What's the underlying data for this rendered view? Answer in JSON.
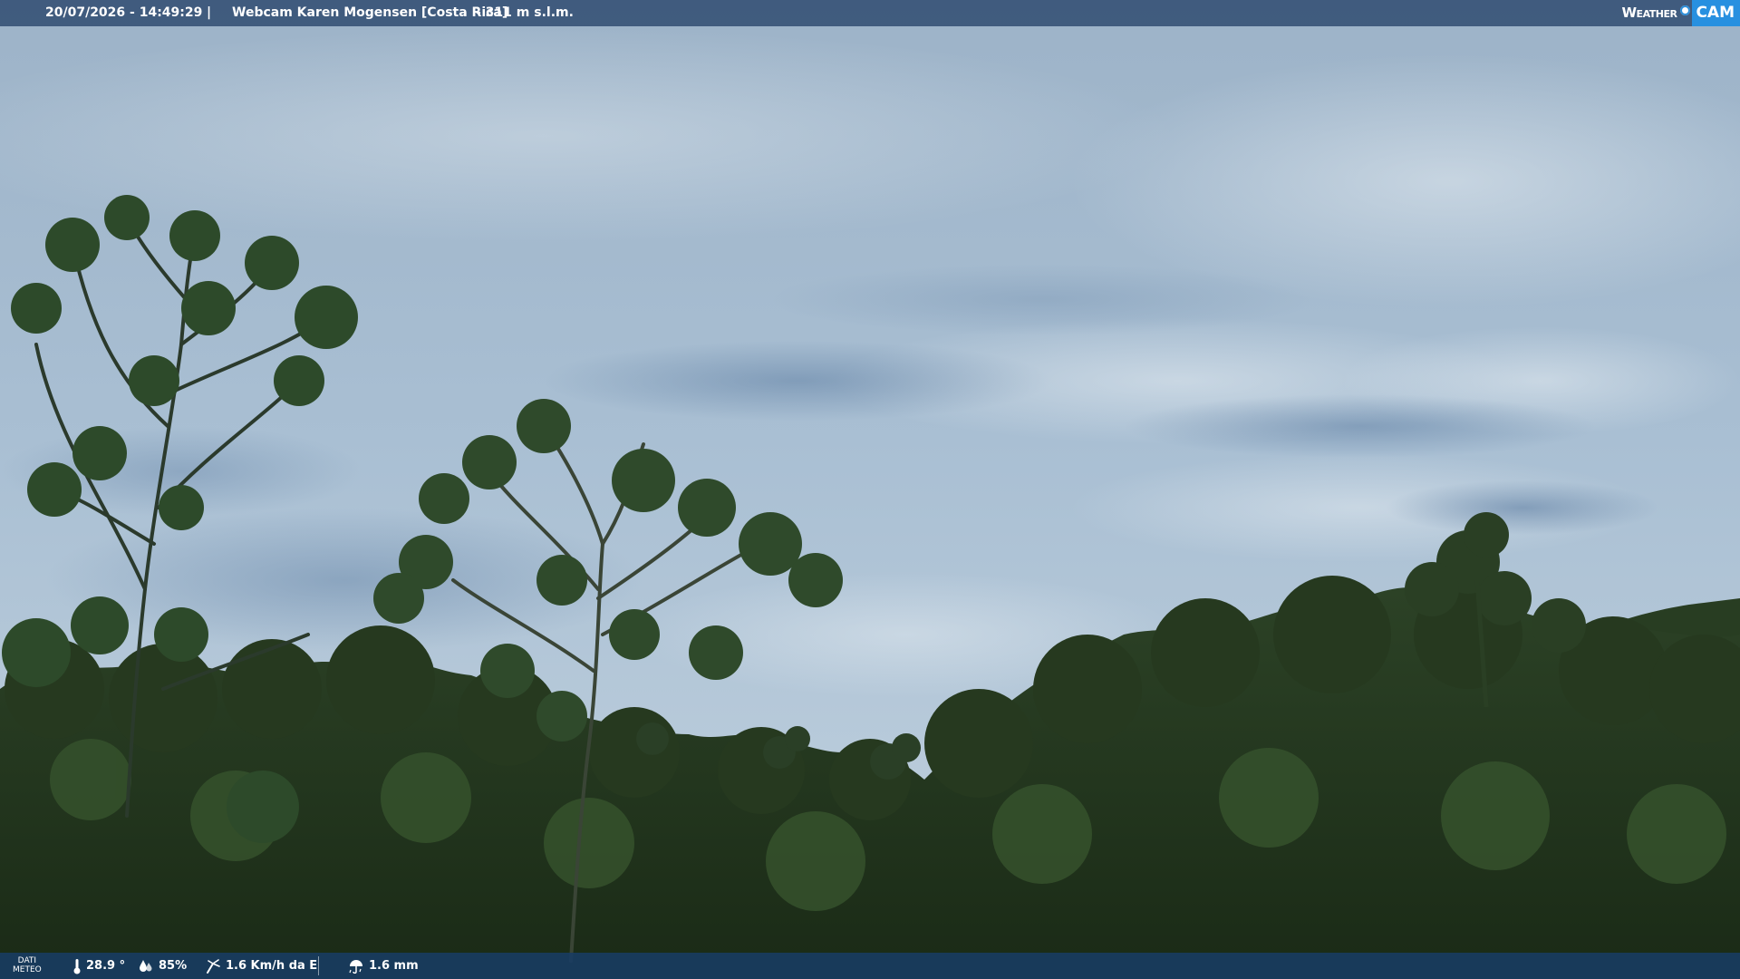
{
  "header": {
    "timestamp": "20/07/2026 - 14:49:29",
    "separator": "|",
    "title": "Webcam Karen Mogensen [Costa Rica]",
    "altitude": "- 311 m s.l.m."
  },
  "logo": {
    "weather": "Weather",
    "cam": "CAM",
    "colors": {
      "cam_bg": "#2790e0"
    }
  },
  "weather": {
    "label_line1": "DATI",
    "label_line2": "METEO",
    "temperature": "28.9 °",
    "humidity": "85%",
    "wind": "1.6 Km/h da E",
    "rain": "1.6 mm",
    "icons": [
      "thermometer-icon",
      "humidity-icon",
      "wind-icon",
      "rain-icon"
    ]
  },
  "colors": {
    "bar_top": "#2c486e",
    "bar_bottom": "#183c64",
    "sky": "#a9bfd3",
    "forest": "#1f331a"
  }
}
